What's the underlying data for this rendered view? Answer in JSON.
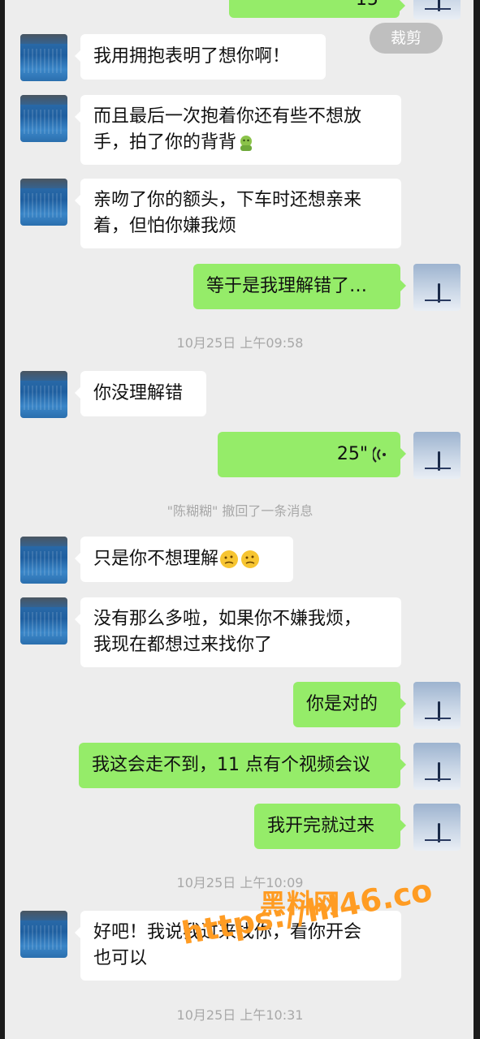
{
  "toolbar": {
    "crop_label": "裁剪"
  },
  "messages": [
    {
      "side": "left",
      "text": "我用拥抱表明了想你啊！"
    },
    {
      "side": "left",
      "lines": [
        "而且最后一次抱着你还有些不想放",
        "手，拍了你的背背"
      ],
      "trailing_icon": "green-face-emoji"
    },
    {
      "side": "left",
      "lines": [
        "亲吻了你的额头，下车时还想亲来",
        "着，但怕你嫌我烦"
      ]
    },
    {
      "side": "right",
      "text": "等于是我理解错了…"
    },
    {
      "side": "left",
      "text": "你没理解错"
    },
    {
      "side": "right",
      "type": "voice",
      "duration": "25\"",
      "icon": "voice-wave-icon"
    },
    {
      "side": "left",
      "text": "只是你不想理解",
      "trailing_icon": "thinking-face-emoji"
    },
    {
      "side": "left",
      "lines": [
        "没有那么多啦，如果你不嫌我烦，",
        "我现在都想过来找你了"
      ]
    },
    {
      "side": "right",
      "text": "你是对的"
    },
    {
      "side": "right",
      "text": "我这会走不到，11 点有个视频会议"
    },
    {
      "side": "right",
      "text": "我开完就过来"
    },
    {
      "side": "left",
      "lines": [
        "好吧！我说我过来找你，看你开会",
        "也可以"
      ]
    }
  ],
  "timestamps": {
    "t1": "10月25日 上午09:58",
    "t2": "10月25日 上午10:09",
    "t3": "10月25日 上午10:31"
  },
  "system_notice": "\"陈糊糊\" 撤回了一条消息",
  "partial_top_voice": "15\"",
  "watermark": {
    "line1": "黑料网",
    "line2": "https://hl46.co"
  },
  "colors": {
    "background": "#ededed",
    "sent_bubble": "#95ec69",
    "received_bubble": "#ffffff",
    "watermark": "#ff9c23"
  }
}
